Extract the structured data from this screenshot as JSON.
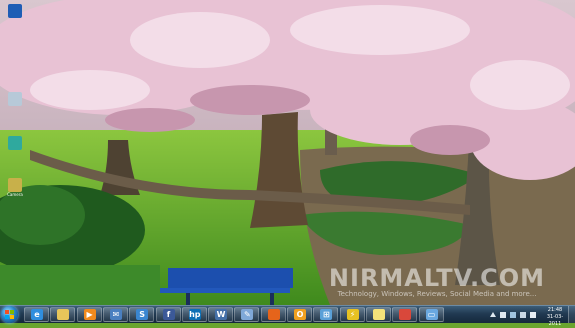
{
  "desktop": {
    "icons": [
      {
        "name": "icon-1",
        "label": ""
      },
      {
        "name": "icon-2",
        "label": ""
      },
      {
        "name": "icon-3",
        "label": ""
      },
      {
        "name": "icon-4",
        "label": "Camera"
      }
    ]
  },
  "watermark": {
    "title": "NIRMALTV.COM",
    "tagline": "Technology, Windows, Reviews, Social Media and more..."
  },
  "taskbar": {
    "pinned": [
      {
        "name": "internet-explorer-icon",
        "glyph": "e",
        "color": "#2f8ede"
      },
      {
        "name": "folder-icon",
        "glyph": "",
        "color": "#e7c65a"
      },
      {
        "name": "media-player-icon",
        "glyph": "▶",
        "color": "#f08a1e"
      },
      {
        "name": "mail-icon",
        "glyph": "✉",
        "color": "#4a7fc0"
      },
      {
        "name": "messenger-icon",
        "glyph": "S",
        "color": "#3a86d1"
      },
      {
        "name": "facebook-icon",
        "glyph": "f",
        "color": "#3b5998"
      },
      {
        "name": "hp-icon",
        "glyph": "hp",
        "color": "#0b6fb5"
      },
      {
        "name": "writer-icon",
        "glyph": "W",
        "color": "#4470a8"
      },
      {
        "name": "paint-icon",
        "glyph": "✎",
        "color": "#7fa8d8"
      },
      {
        "name": "firefox-icon",
        "glyph": "",
        "color": "#e5641b"
      },
      {
        "name": "office-icon",
        "glyph": "O",
        "color": "#f0a020"
      },
      {
        "name": "network-icon",
        "glyph": "⊞",
        "color": "#5aa0d8"
      },
      {
        "name": "winamp-icon",
        "glyph": "⚡",
        "color": "#e7c222"
      },
      {
        "name": "notes-icon",
        "glyph": "",
        "color": "#f4e27a"
      },
      {
        "name": "chrome-icon",
        "glyph": "",
        "color": "#d9483b"
      },
      {
        "name": "display-icon",
        "glyph": "▭",
        "color": "#6aa8e0"
      }
    ],
    "clock": {
      "time": "21:48",
      "date": "31-03-2011"
    }
  }
}
